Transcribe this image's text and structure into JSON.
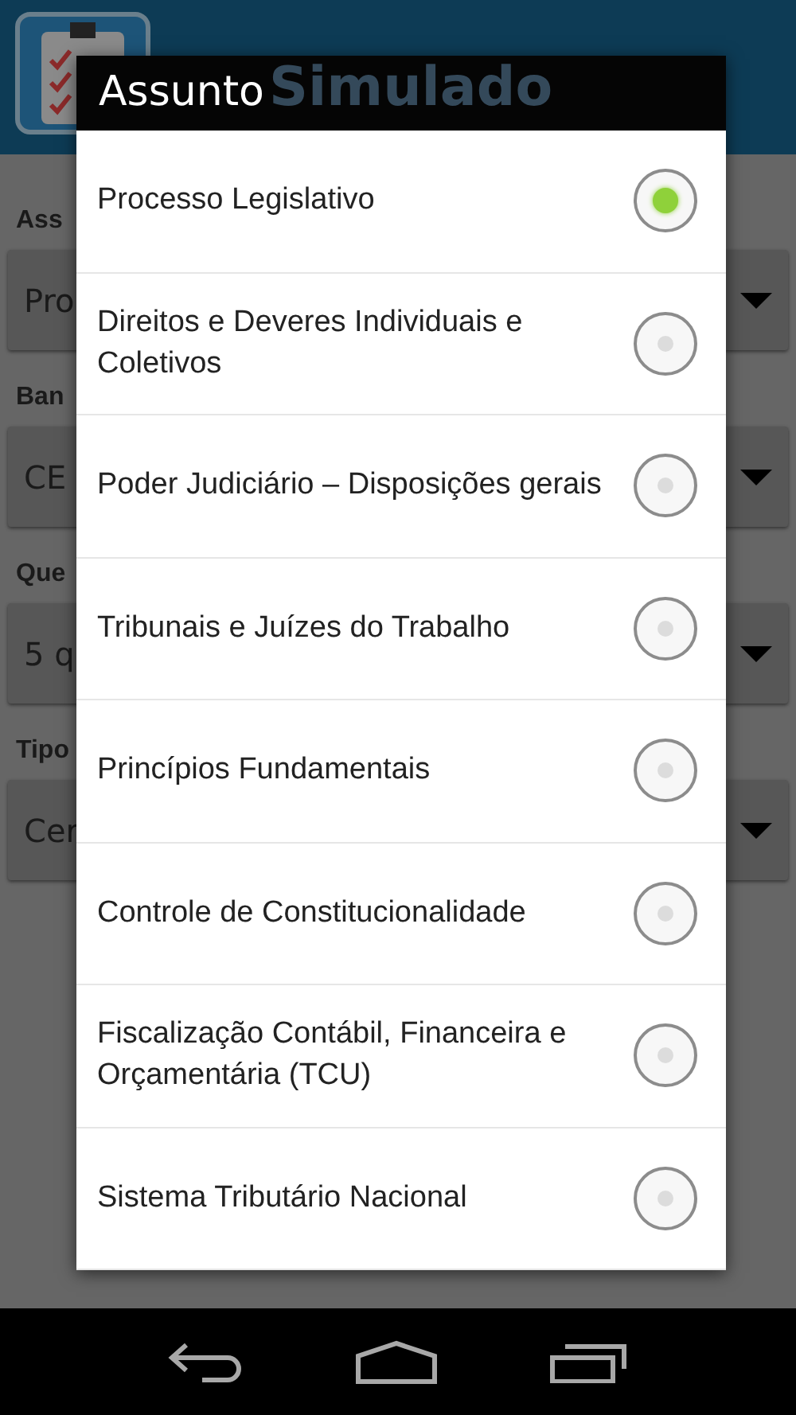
{
  "app_bar": {
    "title": "Simulado"
  },
  "form": [
    {
      "label": "Ass",
      "value": "Pro"
    },
    {
      "label": "Ban",
      "value": "CE"
    },
    {
      "label": "Que",
      "value": "5 q"
    },
    {
      "label": "Tipo",
      "value": "Cer"
    }
  ],
  "dialog": {
    "title": "Assunto",
    "options": [
      {
        "label": "Processo Legislativo",
        "selected": true
      },
      {
        "label": "Direitos e Deveres Individuais e Coletivos",
        "selected": false
      },
      {
        "label": "Poder Judiciário – Disposições gerais",
        "selected": false
      },
      {
        "label": "Tribunais e Juízes do Trabalho",
        "selected": false
      },
      {
        "label": "Princípios Fundamentais",
        "selected": false
      },
      {
        "label": "Controle de Constitucionalidade",
        "selected": false
      },
      {
        "label": "Fiscalização Contábil, Financeira e Orçamentária (TCU)",
        "selected": false
      },
      {
        "label": "Sistema Tributário Nacional",
        "selected": false
      }
    ]
  }
}
